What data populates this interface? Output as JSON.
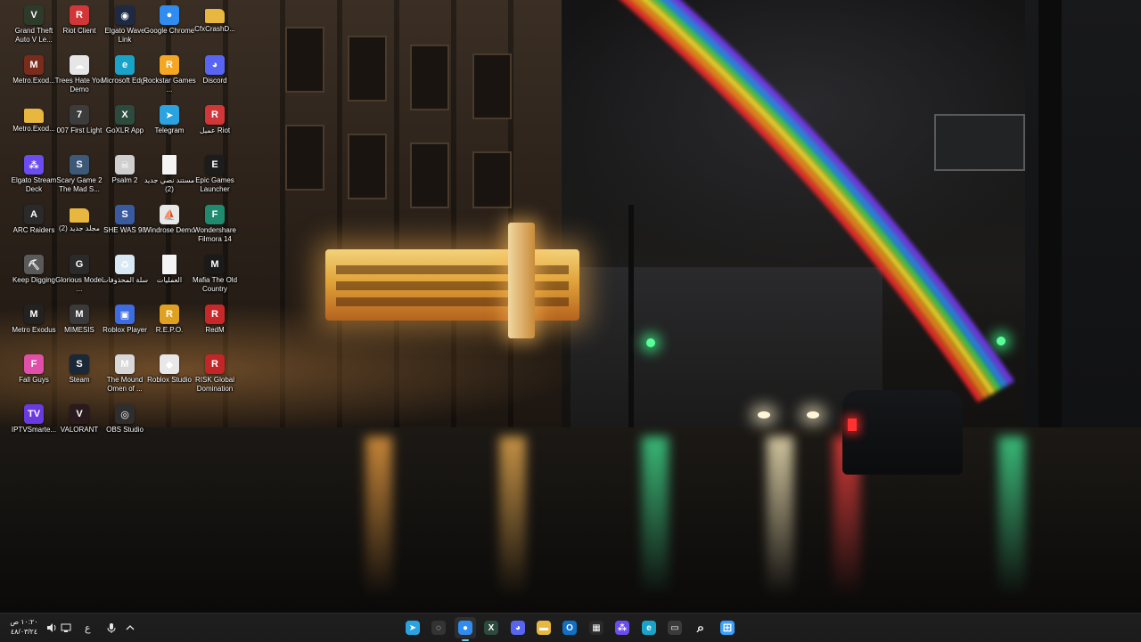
{
  "desktop": {
    "icons": [
      {
        "label": "Grand Theft Auto V Le...",
        "icon": "gta-v-icon",
        "color": "#2e3b2a",
        "glyph": "V"
      },
      {
        "label": "Riot Client",
        "icon": "riot-client-icon",
        "color": "#d13639",
        "glyph": "R"
      },
      {
        "label": "Elgato Wave Link",
        "icon": "elgato-wave-icon",
        "color": "#1e2a44",
        "glyph": "◉"
      },
      {
        "label": "Google Chrome",
        "icon": "chrome-icon",
        "color": "#2f8cf0",
        "glyph": "●"
      },
      {
        "label": "CfxCrashD...",
        "icon": "folder-icon",
        "color": "#e8b740",
        "glyph": ""
      },
      {
        "label": "Metro.Exod...",
        "icon": "metro-exodus-icon",
        "color": "#7a2c1c",
        "glyph": "M"
      },
      {
        "label": "Trees Hate You Demo",
        "icon": "trees-hate-you-icon",
        "color": "#e6e6e6",
        "glyph": "☁"
      },
      {
        "label": "Microsoft Edge",
        "icon": "edge-icon",
        "color": "#1aa3c9",
        "glyph": "e"
      },
      {
        "label": "Rockstar Games ...",
        "icon": "rockstar-icon",
        "color": "#f5a623",
        "glyph": "R"
      },
      {
        "label": "Discord",
        "icon": "discord-icon",
        "color": "#5865f2",
        "glyph": "◕"
      },
      {
        "label": "Metro.Exod...",
        "icon": "folder-icon",
        "color": "#e8b740",
        "glyph": ""
      },
      {
        "label": "007 First Light",
        "icon": "007-first-light-icon",
        "color": "#3c3c3c",
        "glyph": "7"
      },
      {
        "label": "GoXLR App",
        "icon": "goxlr-icon",
        "color": "#2c4a3e",
        "glyph": "X"
      },
      {
        "label": "Telegram",
        "icon": "telegram-icon",
        "color": "#2aa3e0",
        "glyph": "➤"
      },
      {
        "label": "عميل Riot",
        "icon": "riot-client-icon",
        "color": "#d13639",
        "glyph": "R"
      },
      {
        "label": "Elgato Stream Deck",
        "icon": "stream-deck-icon",
        "color": "#6a4cf0",
        "glyph": "⁂"
      },
      {
        "label": "Scary Game 2 The Mad S...",
        "icon": "scary-game-icon",
        "color": "#3c5a78",
        "glyph": "S"
      },
      {
        "label": "Psalm 2",
        "icon": "psalm-2-icon",
        "color": "#cfcfcf",
        "glyph": "☠"
      },
      {
        "label": "مستند نصي جديد (2)",
        "icon": "text-document-icon",
        "color": "#f4f4f4",
        "glyph": ""
      },
      {
        "label": "Epic Games Launcher",
        "icon": "epic-games-icon",
        "color": "#1c1c1c",
        "glyph": "E"
      },
      {
        "label": "ARC Raiders",
        "icon": "arc-raiders-icon",
        "color": "#2a2a2a",
        "glyph": "A"
      },
      {
        "label": "مجلد جديد (2)",
        "icon": "folder-icon",
        "color": "#e8b740",
        "glyph": ""
      },
      {
        "label": "SHE WAS 98",
        "icon": "she-was-98-icon",
        "color": "#3a5aa0",
        "glyph": "S"
      },
      {
        "label": "Windrose Demo",
        "icon": "windrose-icon",
        "color": "#e8e8e8",
        "glyph": "⛵"
      },
      {
        "label": "Wondershare Filmora 14",
        "icon": "filmora-icon",
        "color": "#1f8a6e",
        "glyph": "F"
      },
      {
        "label": "Keep Digging",
        "icon": "keep-digging-icon",
        "color": "#5a5a5a",
        "glyph": "⛏"
      },
      {
        "label": "Glorious Model ...",
        "icon": "glorious-mouse-icon",
        "color": "#2a2a2a",
        "glyph": "G"
      },
      {
        "label": "سلة المحذوفات",
        "icon": "recycle-bin-icon",
        "color": "#d8e8f4",
        "glyph": "♻"
      },
      {
        "label": "العمليات",
        "icon": "text-document-icon",
        "color": "#f4f4f4",
        "glyph": ""
      },
      {
        "label": "Mafia The Old Country",
        "icon": "mafia-icon",
        "color": "#1a1a1a",
        "glyph": "M"
      },
      {
        "label": "Metro Exodus",
        "icon": "metro-exodus-icon",
        "color": "#222",
        "glyph": "M"
      },
      {
        "label": "MIMESIS",
        "icon": "mimesis-icon",
        "color": "#3a3a3a",
        "glyph": "M"
      },
      {
        "label": "Roblox Player",
        "icon": "roblox-player-icon",
        "color": "#3d6be0",
        "glyph": "▣"
      },
      {
        "label": "R.E.P.O.",
        "icon": "repo-icon",
        "color": "#e0a020",
        "glyph": "R"
      },
      {
        "label": "RedM",
        "icon": "redm-icon",
        "color": "#c8282a",
        "glyph": "R"
      },
      {
        "label": "Fall Guys",
        "icon": "fall-guys-icon",
        "color": "#e04fa8",
        "glyph": "F"
      },
      {
        "label": "Steam",
        "icon": "steam-icon",
        "color": "#1b2838",
        "glyph": "S"
      },
      {
        "label": "The Mound Omen of ...",
        "icon": "the-mound-icon",
        "color": "#d8d8d8",
        "glyph": "M"
      },
      {
        "label": "Roblox Studio",
        "icon": "roblox-studio-icon",
        "color": "#e8e8e8",
        "glyph": "◆"
      },
      {
        "label": "RISK Global Domination",
        "icon": "risk-icon",
        "color": "#c22626",
        "glyph": "R"
      },
      {
        "label": "IPTVSmarte...",
        "icon": "iptv-smarters-icon",
        "color": "#6a3ae0",
        "glyph": "TV"
      },
      {
        "label": "VALORANT",
        "icon": "valorant-icon",
        "color": "#2a1a1e",
        "glyph": "V"
      },
      {
        "label": "OBS Studio",
        "icon": "obs-studio-icon",
        "color": "#2e2e2e",
        "glyph": "◎"
      }
    ]
  },
  "taskbar": {
    "clock_time": "١٠:٢٠ ص",
    "clock_date": "٤٨/٠٣/٢٤",
    "language": "ع",
    "tray_icons": [
      "speaker-icon",
      "network-icon",
      "microphone-icon",
      "chevron-up-icon"
    ],
    "apps": [
      {
        "icon": "telegram-icon",
        "color": "#2aa3e0",
        "glyph": "➤",
        "active": false
      },
      {
        "icon": "github-copilot-icon",
        "color": "#333333",
        "glyph": "◌",
        "active": false
      },
      {
        "icon": "chrome-icon",
        "color": "#2f8cf0",
        "glyph": "●",
        "active": true
      },
      {
        "icon": "goxlr-icon",
        "color": "#2c4a3e",
        "glyph": "X",
        "active": false
      },
      {
        "icon": "discord-icon",
        "color": "#5865f2",
        "glyph": "◕",
        "active": false
      },
      {
        "icon": "file-explorer-icon",
        "color": "#e8b740",
        "glyph": "▬",
        "active": false
      },
      {
        "icon": "outlook-icon",
        "color": "#1170c4",
        "glyph": "O",
        "active": false
      },
      {
        "icon": "microsoft-store-icon",
        "color": "#2a2a2a",
        "glyph": "▦",
        "active": false
      },
      {
        "icon": "stream-deck-icon",
        "color": "#6a4cf0",
        "glyph": "⁂",
        "active": false
      },
      {
        "icon": "edge-icon",
        "color": "#1aa3c9",
        "glyph": "e",
        "active": false
      },
      {
        "icon": "task-view-icon",
        "color": "#3a3a3a",
        "glyph": "▭",
        "active": false
      },
      {
        "icon": "search-icon",
        "color": "#1f1f1f",
        "glyph": "⌕",
        "active": false
      },
      {
        "icon": "start-icon",
        "color": "#1f6fe0",
        "glyph": "⊞",
        "active": false
      }
    ]
  }
}
